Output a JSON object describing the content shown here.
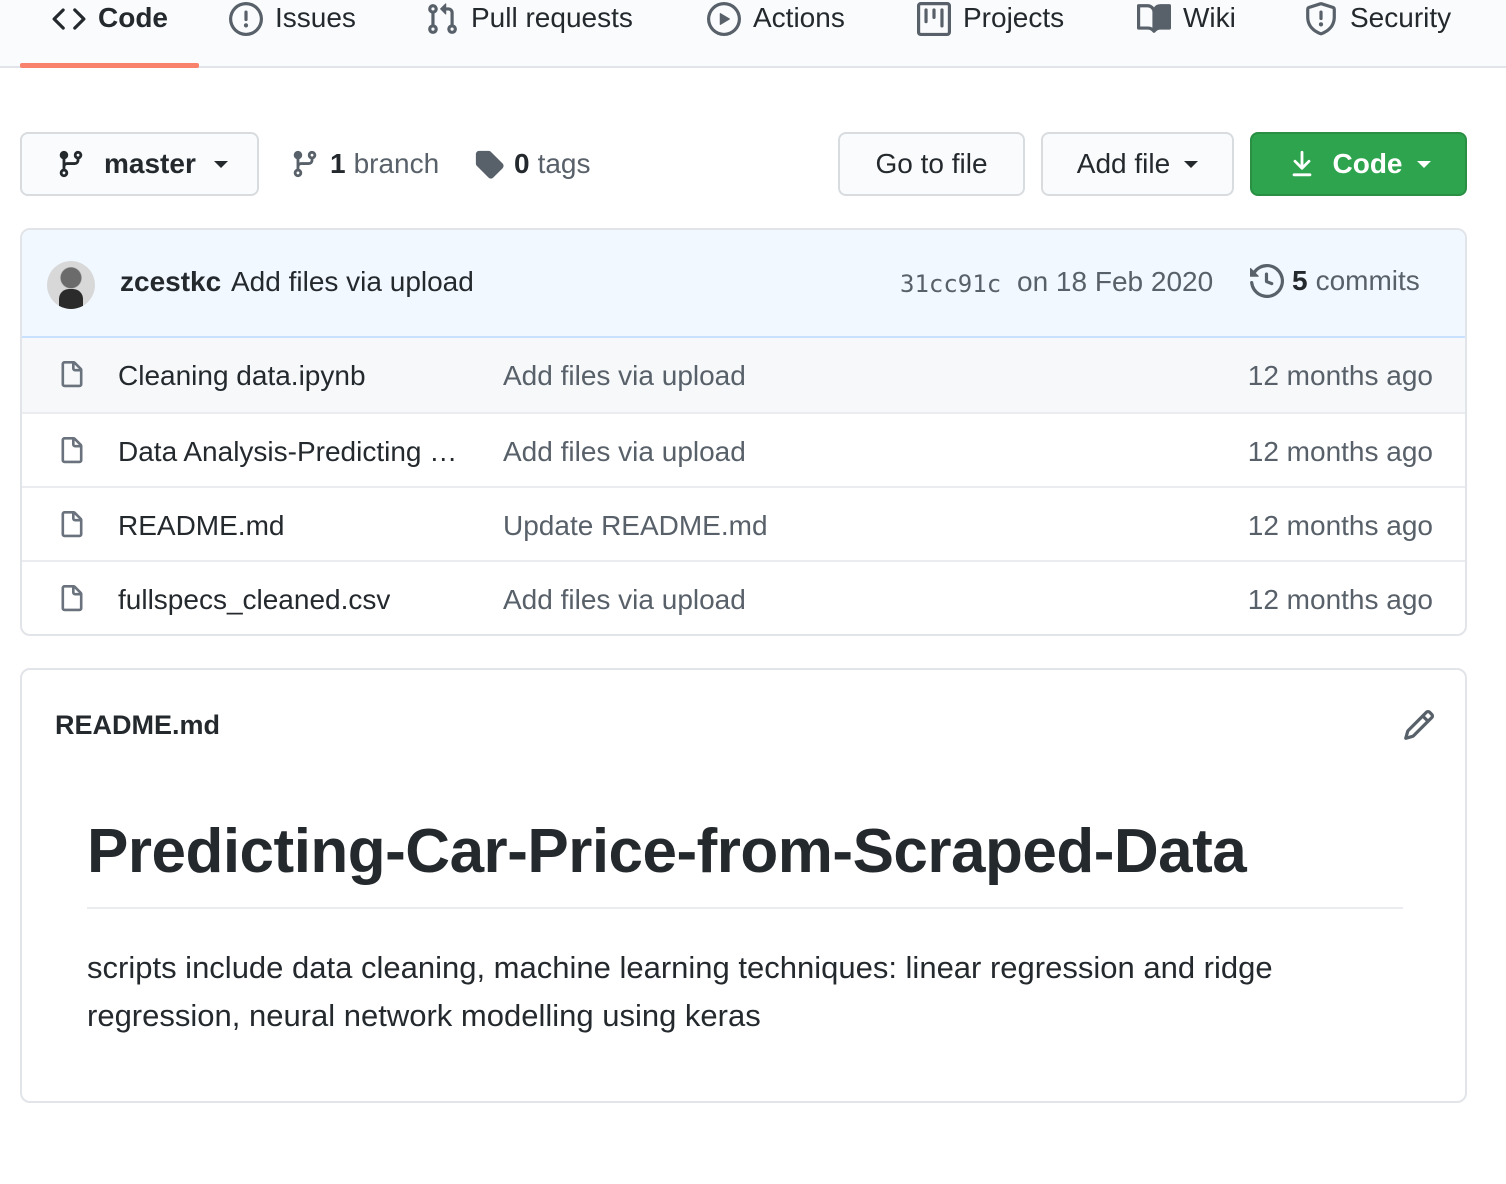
{
  "nav": {
    "tabs": [
      {
        "label": "Code",
        "icon": "code-icon",
        "selected": true
      },
      {
        "label": "Issues",
        "icon": "issue-opened-icon"
      },
      {
        "label": "Pull requests",
        "icon": "git-pull-request-icon"
      },
      {
        "label": "Actions",
        "icon": "play-icon"
      },
      {
        "label": "Projects",
        "icon": "project-icon"
      },
      {
        "label": "Wiki",
        "icon": "book-icon"
      },
      {
        "label": "Security",
        "icon": "shield-icon"
      }
    ],
    "accent_color": "#f9826c"
  },
  "branch_bar": {
    "branch_name": "master",
    "branch_count": "1",
    "branch_label": "branch",
    "tag_count": "0",
    "tag_label": "tags",
    "goto_file_label": "Go to file",
    "add_file_label": "Add file",
    "code_label": "Code",
    "code_button_color": "#2ea44f"
  },
  "latest_commit": {
    "author": "zcestkc",
    "message": "Add files via upload",
    "sha": "31cc91c",
    "date": "on 18 Feb 2020",
    "commit_count": "5",
    "commit_label": "commits"
  },
  "files": [
    {
      "name": "Cleaning data.ipynb",
      "commit_message": "Add files via upload",
      "age": "12 months ago"
    },
    {
      "name": "Data Analysis-Predicting …",
      "commit_message": "Add files via upload",
      "age": "12 months ago"
    },
    {
      "name": "README.md",
      "commit_message": "Update README.md",
      "age": "12 months ago"
    },
    {
      "name": "fullspecs_cleaned.csv",
      "commit_message": "Add files via upload",
      "age": "12 months ago"
    }
  ],
  "readme": {
    "filename": "README.md",
    "heading": "Predicting-Car-Price-from-Scraped-Data",
    "body": "scripts include data cleaning, machine learning techniques: linear regression and ridge regression, neural network modelling using keras"
  }
}
